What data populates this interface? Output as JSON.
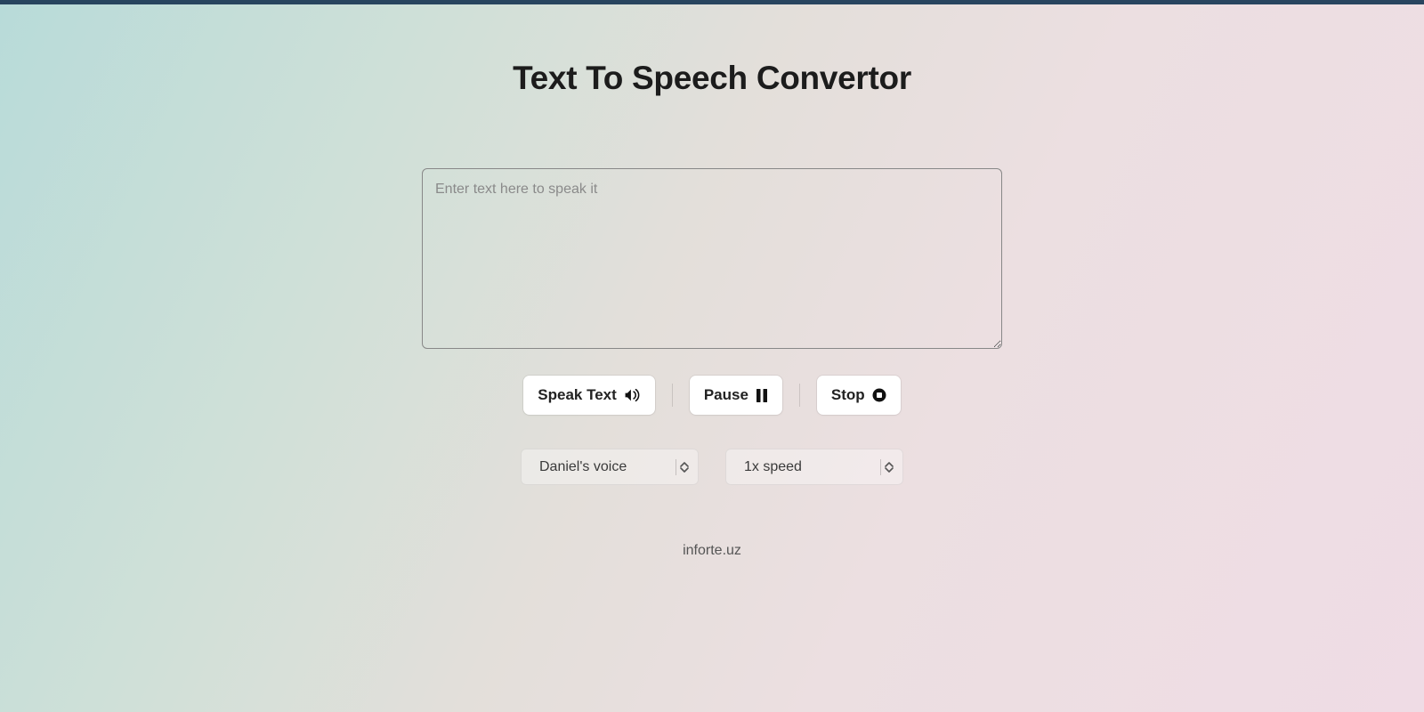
{
  "title": "Text To Speech Convertor",
  "textarea": {
    "placeholder": "Enter text here to speak it",
    "value": ""
  },
  "buttons": {
    "speak": "Speak Text",
    "pause": "Pause",
    "stop": "Stop"
  },
  "selects": {
    "voice": "Daniel's voice",
    "speed": "1x speed"
  },
  "footer": "inforte.uz"
}
